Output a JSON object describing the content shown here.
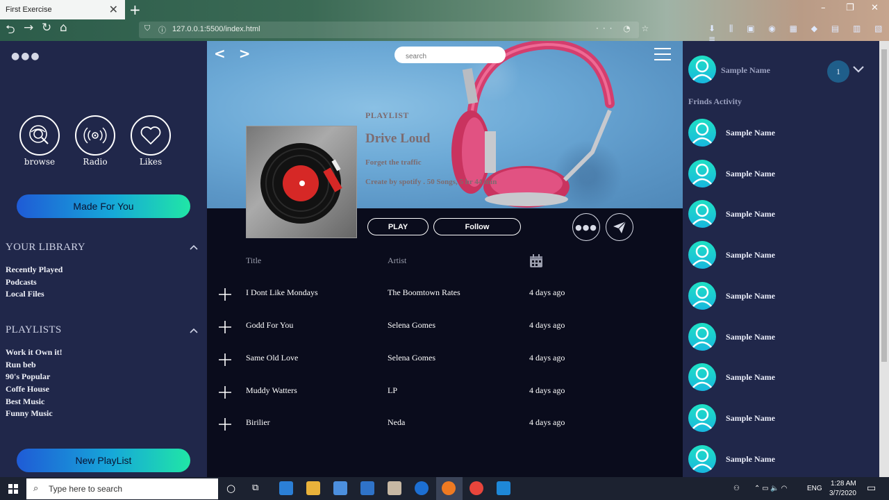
{
  "browser": {
    "tab_title": "First Exercise",
    "tab_close": "✕",
    "new_tab": "+",
    "url": "127.0.0.1:5500/index.html",
    "url_actions": "··· ◔ ☆",
    "window_controls": {
      "minimize": "–",
      "maximize": "❐",
      "close": "✕"
    }
  },
  "left": {
    "menu_icon": "dots-icon",
    "circle_buttons": [
      {
        "label": "browse",
        "icon": "browse-icon"
      },
      {
        "label": "Radio",
        "icon": "radio-icon"
      },
      {
        "label": "Likes",
        "icon": "heart-icon"
      }
    ],
    "made_for_you": "Made For You",
    "library_title": "YOUR LIBRARY",
    "library_items": [
      "Recently Played",
      "Podcasts",
      "Local Files"
    ],
    "playlists_title": "PLAYLISTS",
    "playlist_items": [
      "Work it Own it!",
      "Run beb",
      "90's Popular",
      "Coffe House",
      "Best Music",
      "Funny Music"
    ],
    "new_playlist": "New PlayList"
  },
  "center": {
    "search_placeholder": "search",
    "playlist_label": "PLAYLIST",
    "playlist_title": "Drive Loud",
    "playlist_desc": "Forget the traffic",
    "playlist_meta": "Create by spotify . 50 Songs, 5 hr 44 min",
    "play_label": "PLAY",
    "follow_label": "Follow",
    "columns": {
      "title": "Title",
      "artist": "Artist"
    },
    "tracks": [
      {
        "title": "I Dont Like Mondays",
        "artist": "The Boomtown Rates",
        "added": "4 days ago"
      },
      {
        "title": "Godd For You",
        "artist": "Selena Gomes",
        "added": "4 days ago"
      },
      {
        "title": "Same Old Love",
        "artist": "Selena Gomes",
        "added": "4 days ago"
      },
      {
        "title": "Muddy Watters",
        "artist": "LP",
        "added": "4 days ago"
      },
      {
        "title": "Birilier",
        "artist": "Neda",
        "added": "4 days ago"
      }
    ]
  },
  "right": {
    "user_name": "Sample Name",
    "notification_count": "1",
    "friends_title": "Frinds Activity",
    "friends": [
      "Sample Name",
      "Sample Name",
      "Sample Name",
      "Sample Name",
      "Sample Name",
      "Sample Name",
      "Sample Name",
      "Sample Name",
      "Sample Name"
    ]
  },
  "taskbar": {
    "search_placeholder": "Type here to search",
    "language": "ENG",
    "time": "1:28 AM",
    "date": "3/7/2020"
  },
  "colors": {
    "sidebar": "#20274a",
    "main": "#0a0c1c",
    "accent_start": "#1f5bd6",
    "accent_end": "#20e6a6",
    "avatar": "#1fd1cf"
  }
}
